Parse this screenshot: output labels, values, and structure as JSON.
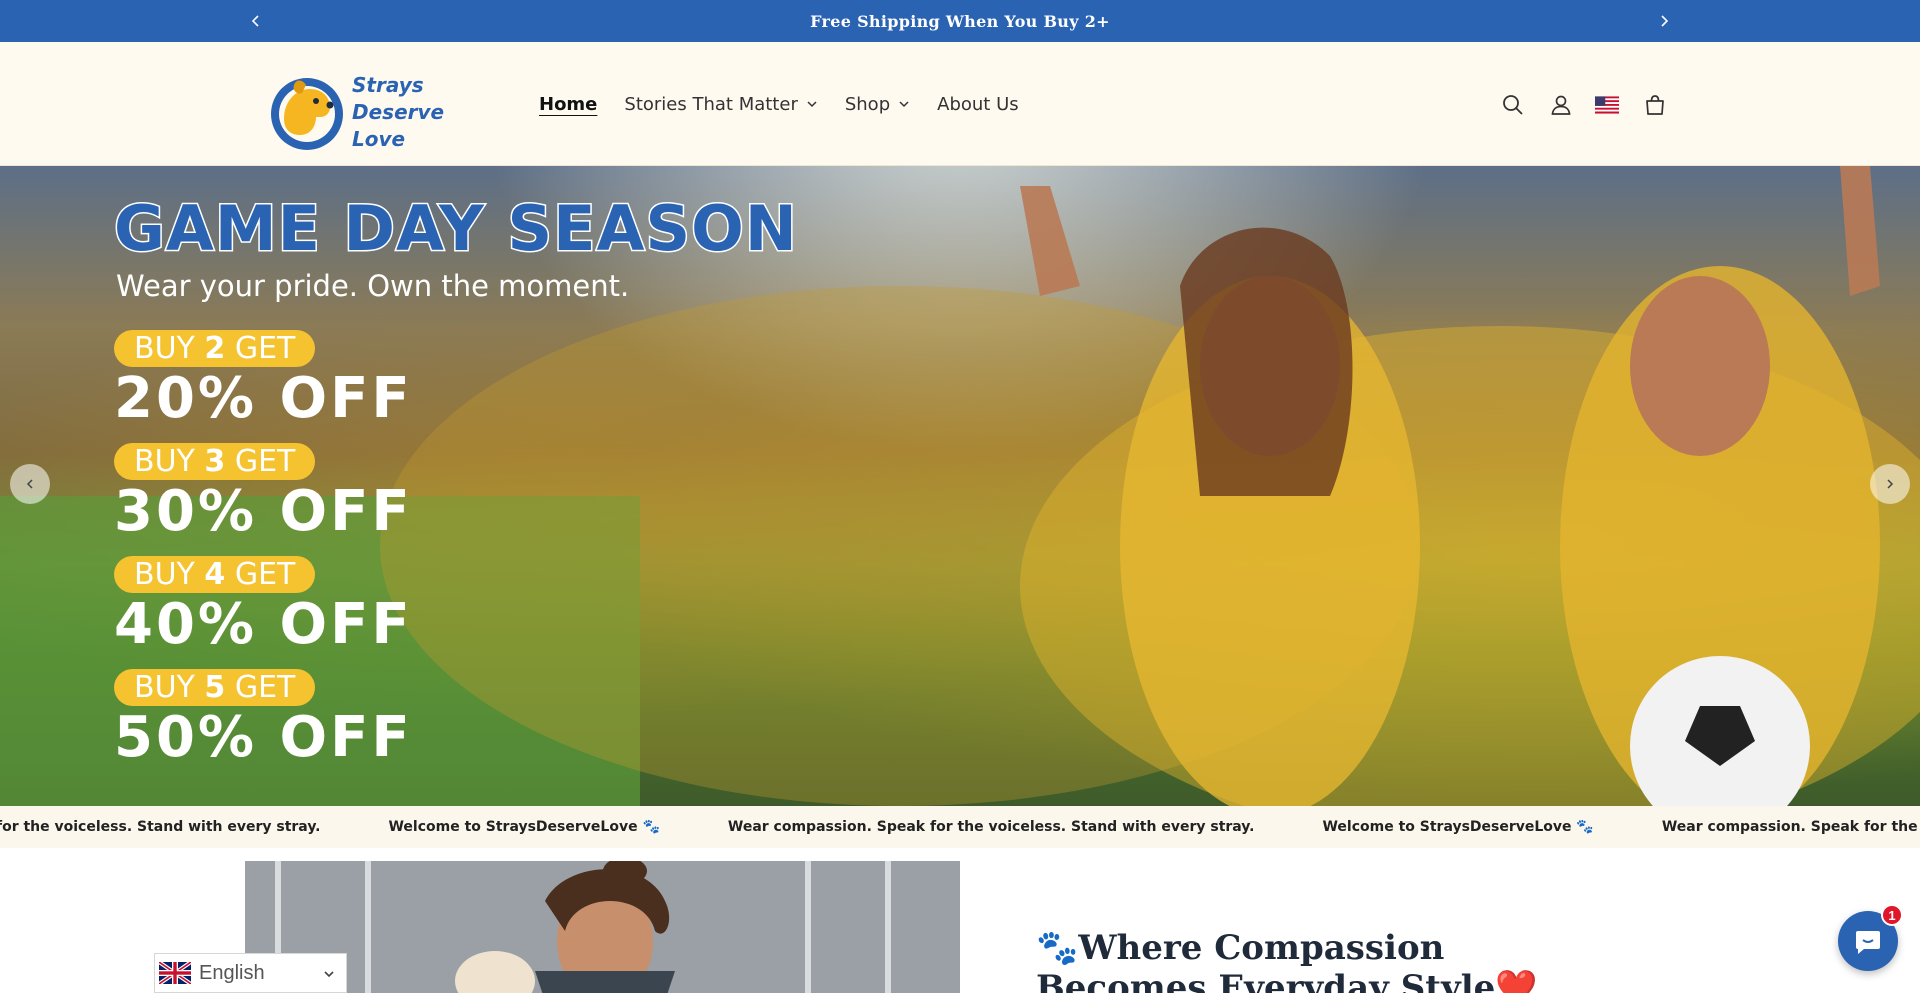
{
  "announcement": {
    "message": "Free Shipping When You Buy 2+",
    "prev_icon": "chevron-left-icon",
    "next_icon": "chevron-right-icon"
  },
  "header": {
    "logo_line1": "Strays",
    "logo_line2": "Deserve Love",
    "nav": [
      {
        "label": "Home",
        "active": true,
        "dropdown": false
      },
      {
        "label": "Stories That Matter",
        "active": false,
        "dropdown": true
      },
      {
        "label": "Shop",
        "active": false,
        "dropdown": true
      },
      {
        "label": "About Us",
        "active": false,
        "dropdown": false
      }
    ],
    "icons": [
      "search-icon",
      "account-icon",
      "us-flag-icon",
      "cart-icon"
    ]
  },
  "hero": {
    "headline": "GAME DAY SEASON",
    "subheadline": "Wear your pride. Own the moment.",
    "offers": [
      {
        "buy_prefix": "BUY ",
        "qty": "2",
        "buy_suffix": " GET",
        "discount": "20% OFF"
      },
      {
        "buy_prefix": "BUY ",
        "qty": "3",
        "buy_suffix": " GET",
        "discount": "30% OFF"
      },
      {
        "buy_prefix": "BUY ",
        "qty": "4",
        "buy_suffix": " GET",
        "discount": "40% OFF"
      },
      {
        "buy_prefix": "BUY ",
        "qty": "5",
        "buy_suffix": " GET",
        "discount": "50% OFF"
      }
    ],
    "colors": {
      "brand_blue": "#2b63b3",
      "pill_yellow": "#f5c230"
    }
  },
  "marquee": {
    "items": [
      "for the voiceless. Stand with every stray.",
      "Welcome to StraysDeserveLove 🐾",
      "Wear compassion. Speak for the voiceless. Stand with every stray.",
      "Welcome to StraysDeserveLove 🐾",
      "Wear compassion. Speak for the voiceless. Stand with every stray."
    ]
  },
  "feature": {
    "heading": "🐾Where Compassion Becomes Everyday Style❤️"
  },
  "language": {
    "selected": "English",
    "flag_icon": "uk-flag-icon"
  },
  "chat": {
    "badge_count": "1"
  }
}
